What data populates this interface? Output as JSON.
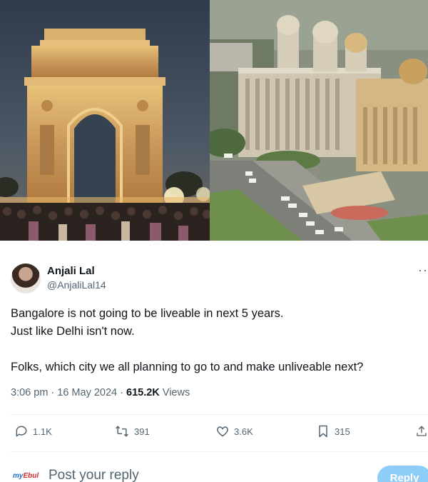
{
  "images": {
    "left_photo": "India Gate photo",
    "right_photo": "Vidhana Soudha photo"
  },
  "tweet": {
    "author_name": "Anjali Lal",
    "author_handle": "@AnjaliLal14",
    "more_icon": "more-icon",
    "text_line1": "Bangalore is not going to be liveable in next 5 years.",
    "text_line2": "Just like Delhi isn't now.",
    "text_line3": "Folks, which city we all planning to go to and make unliveable next?",
    "timestamp": "3:06 pm · 16 May 2024 · ",
    "views_count": "615.2K",
    "views_label": " Views"
  },
  "actions": {
    "replies": "1.1K",
    "retweets": "391",
    "likes": "3.6K",
    "bookmarks": "315"
  },
  "reply_bar": {
    "brand_logo_part1": "my",
    "brand_logo_part2": "Ebul",
    "placeholder": "Post your reply",
    "button_label": "Reply"
  },
  "colors": {
    "text_primary": "#0f1419",
    "text_secondary": "#536471",
    "reply_button": "#8ecdf8",
    "divider": "#eff3f4"
  }
}
